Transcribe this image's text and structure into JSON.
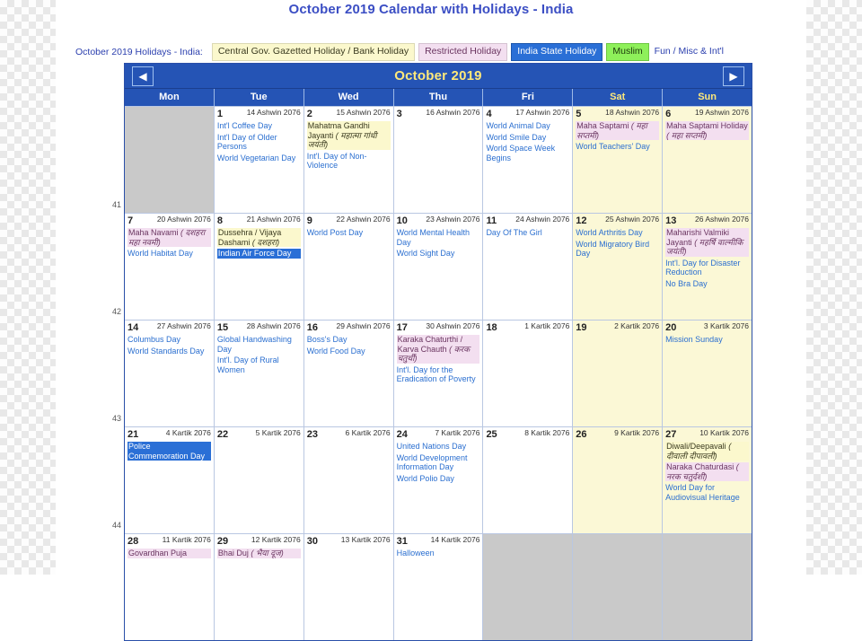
{
  "title": "October 2019 Calendar with Holidays - India",
  "legend": {
    "label": "October 2019 Holidays - India:",
    "items": [
      {
        "text": "Central Gov. Gazetted Holiday / Bank Holiday",
        "type": "central"
      },
      {
        "text": "Restricted Holiday",
        "type": "restricted"
      },
      {
        "text": "India State Holiday",
        "type": "state"
      },
      {
        "text": "Muslim",
        "type": "muslim"
      },
      {
        "text": "Fun / Misc & Int'l",
        "type": "fun"
      }
    ]
  },
  "calendar": {
    "month_title": "October 2019",
    "prev_icon": "◀",
    "next_icon": "▶",
    "dow": [
      "Mon",
      "Tue",
      "Wed",
      "Thu",
      "Fri",
      "Sat",
      "Sun"
    ],
    "week_numbers": [
      "41",
      "42",
      "43",
      "44",
      ""
    ],
    "weeks": [
      [
        {
          "blank": true
        },
        {
          "day": "1",
          "hindu": "14 Ashwin 2076",
          "events": [
            {
              "text": "Int'l Coffee Day",
              "type": "plain"
            },
            {
              "text": "Int'l Day of Older Persons",
              "type": "plain"
            },
            {
              "text": "World Vegetarian Day",
              "type": "plain"
            }
          ]
        },
        {
          "day": "2",
          "hindu": "15 Ashwin 2076",
          "events": [
            {
              "text": "Mahatma Gandhi Jayanti ( महात्मा गांधी जयंती)",
              "type": "central"
            },
            {
              "text": "Int'l. Day of Non-Violence",
              "type": "plain"
            }
          ]
        },
        {
          "day": "3",
          "hindu": "16 Ashwin 2076",
          "events": []
        },
        {
          "day": "4",
          "hindu": "17 Ashwin 2076",
          "events": [
            {
              "text": "World Animal Day",
              "type": "plain"
            },
            {
              "text": "World Smile Day",
              "type": "plain"
            },
            {
              "text": "World Space Week Begins",
              "type": "plain"
            }
          ]
        },
        {
          "day": "5",
          "hindu": "18 Ashwin 2076",
          "weekend": true,
          "events": [
            {
              "text": "Maha Saptami ( महा सप्तमी)",
              "type": "restricted"
            },
            {
              "text": "World Teachers' Day",
              "type": "plain"
            }
          ]
        },
        {
          "day": "6",
          "hindu": "19 Ashwin 2076",
          "weekend": true,
          "events": [
            {
              "text": "Maha Saptami Holiday ( महा सप्तमी)",
              "type": "restricted"
            }
          ]
        }
      ],
      [
        {
          "day": "7",
          "hindu": "20 Ashwin 2076",
          "events": [
            {
              "text": "Maha Navami ( दशहरा महा नवमी)",
              "type": "restricted"
            },
            {
              "text": "World Habitat Day",
              "type": "plain"
            }
          ]
        },
        {
          "day": "8",
          "hindu": "21 Ashwin 2076",
          "events": [
            {
              "text": "Dussehra / Vijaya Dashami ( दशहरा)",
              "type": "central"
            },
            {
              "text": "Indian Air Force Day",
              "type": "state"
            }
          ]
        },
        {
          "day": "9",
          "hindu": "22 Ashwin 2076",
          "events": [
            {
              "text": "World Post Day",
              "type": "plain"
            }
          ]
        },
        {
          "day": "10",
          "hindu": "23 Ashwin 2076",
          "events": [
            {
              "text": "World Mental Health Day",
              "type": "plain"
            },
            {
              "text": "World Sight Day",
              "type": "plain"
            }
          ]
        },
        {
          "day": "11",
          "hindu": "24 Ashwin 2076",
          "events": [
            {
              "text": "Day Of The Girl",
              "type": "plain"
            }
          ]
        },
        {
          "day": "12",
          "hindu": "25 Ashwin 2076",
          "weekend": true,
          "events": [
            {
              "text": "World Arthritis Day",
              "type": "plain"
            },
            {
              "text": "World Migratory Bird Day",
              "type": "plain"
            }
          ]
        },
        {
          "day": "13",
          "hindu": "26 Ashwin 2076",
          "weekend": true,
          "events": [
            {
              "text": "Maharishi Valmiki Jayanti ( महर्षि वाल्मीकि जयंती)",
              "type": "restricted"
            },
            {
              "text": "Int'l. Day for Disaster Reduction",
              "type": "plain"
            },
            {
              "text": "No Bra Day",
              "type": "plain"
            }
          ]
        }
      ],
      [
        {
          "day": "14",
          "hindu": "27 Ashwin 2076",
          "events": [
            {
              "text": "Columbus Day",
              "type": "plain"
            },
            {
              "text": "World Standards Day",
              "type": "plain"
            }
          ]
        },
        {
          "day": "15",
          "hindu": "28 Ashwin 2076",
          "events": [
            {
              "text": "Global Handwashing Day",
              "type": "plain"
            },
            {
              "text": "Int'l. Day of Rural Women",
              "type": "plain"
            }
          ]
        },
        {
          "day": "16",
          "hindu": "29 Ashwin 2076",
          "events": [
            {
              "text": "Boss's Day",
              "type": "plain"
            },
            {
              "text": "World Food Day",
              "type": "plain"
            }
          ]
        },
        {
          "day": "17",
          "hindu": "30 Ashwin 2076",
          "events": [
            {
              "text": "Karaka Chaturthi / Karva Chauth ( करक चतुर्थी)",
              "type": "restricted"
            },
            {
              "text": "Int'l. Day for the Eradication of Poverty",
              "type": "plain"
            }
          ]
        },
        {
          "day": "18",
          "hindu": "1 Kartik 2076",
          "events": []
        },
        {
          "day": "19",
          "hindu": "2 Kartik 2076",
          "weekend": true,
          "events": []
        },
        {
          "day": "20",
          "hindu": "3 Kartik 2076",
          "weekend": true,
          "events": [
            {
              "text": "Mission Sunday",
              "type": "plain"
            }
          ]
        }
      ],
      [
        {
          "day": "21",
          "hindu": "4 Kartik 2076",
          "events": [
            {
              "text": "Police Commemoration Day",
              "type": "state"
            }
          ]
        },
        {
          "day": "22",
          "hindu": "5 Kartik 2076",
          "events": []
        },
        {
          "day": "23",
          "hindu": "6 Kartik 2076",
          "events": []
        },
        {
          "day": "24",
          "hindu": "7 Kartik 2076",
          "events": [
            {
              "text": "United Nations Day",
              "type": "plain"
            },
            {
              "text": "World Development Information Day",
              "type": "plain"
            },
            {
              "text": "World Polio Day",
              "type": "plain"
            }
          ]
        },
        {
          "day": "25",
          "hindu": "8 Kartik 2076",
          "events": []
        },
        {
          "day": "26",
          "hindu": "9 Kartik 2076",
          "weekend": true,
          "events": []
        },
        {
          "day": "27",
          "hindu": "10 Kartik 2076",
          "weekend": true,
          "events": [
            {
              "text": "Diwali/Deepavali ( दीवाली दीपावली)",
              "type": "central"
            },
            {
              "text": "Naraka Chaturdasi ( नरक चतुर्दशी)",
              "type": "restricted"
            },
            {
              "text": "World Day for Audiovisual Heritage",
              "type": "plain"
            }
          ]
        }
      ],
      [
        {
          "day": "28",
          "hindu": "11 Kartik 2076",
          "events": [
            {
              "text": "Govardhan Puja",
              "type": "restricted"
            }
          ]
        },
        {
          "day": "29",
          "hindu": "12 Kartik 2076",
          "events": [
            {
              "text": "Bhai Duj ( भैया दूज)",
              "type": "restricted"
            }
          ]
        },
        {
          "day": "30",
          "hindu": "13 Kartik 2076",
          "events": []
        },
        {
          "day": "31",
          "hindu": "14 Kartik 2076",
          "events": [
            {
              "text": "Halloween",
              "type": "plain"
            }
          ]
        },
        {
          "blank": true
        },
        {
          "blank": true
        },
        {
          "blank": true
        }
      ]
    ]
  }
}
